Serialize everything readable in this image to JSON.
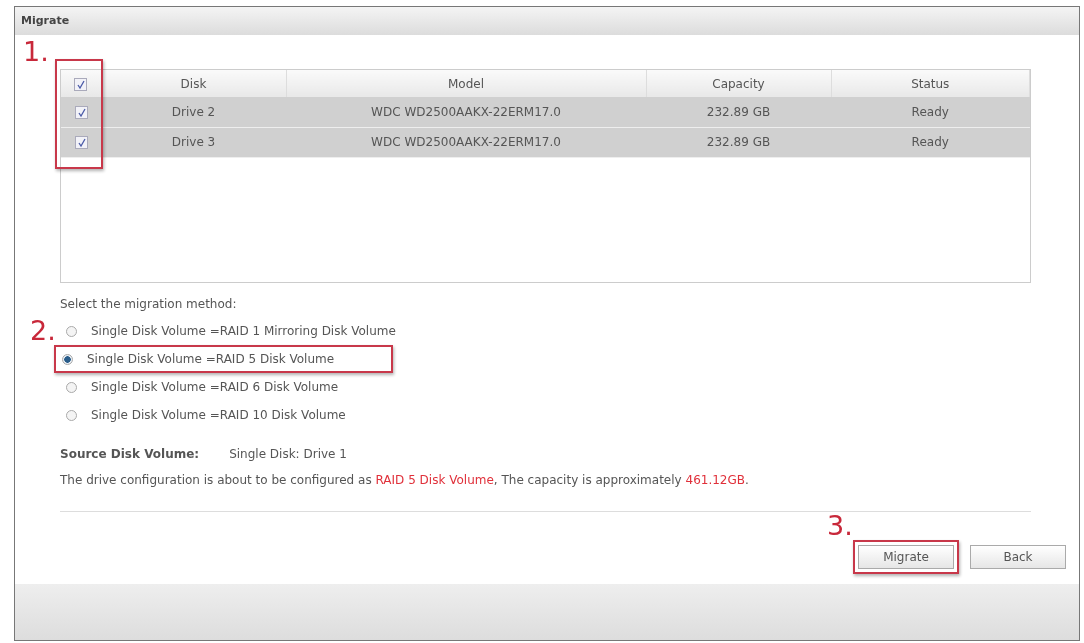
{
  "window": {
    "title": "Migrate"
  },
  "table": {
    "annotation": "1.",
    "annotated_checkboxes": true,
    "all_checked": true,
    "columns": [
      "Disk",
      "Model",
      "Capacity",
      "Status"
    ],
    "rows": [
      {
        "checked": true,
        "selected": true,
        "cells": [
          "Drive 2",
          "WDC WD2500AAKX-22ERM17.0",
          "232.89 GB",
          "Ready"
        ]
      },
      {
        "checked": true,
        "selected": true,
        "cells": [
          "Drive 3",
          "WDC WD2500AAKX-22ERM17.0",
          "232.89 GB",
          "Ready"
        ]
      }
    ]
  },
  "method": {
    "label": "Select the migration method:",
    "annotation": "2.",
    "options": [
      {
        "label": "Single Disk Volume =RAID 1 Mirroring Disk Volume",
        "selected": false,
        "annotated": false
      },
      {
        "label": "Single Disk Volume =RAID 5 Disk Volume",
        "selected": true,
        "annotated": true
      },
      {
        "label": "Single Disk Volume =RAID 6 Disk Volume",
        "selected": false,
        "annotated": false
      },
      {
        "label": "Single Disk Volume =RAID 10 Disk Volume",
        "selected": false,
        "annotated": false
      }
    ]
  },
  "source": {
    "label": "Source Disk Volume:",
    "value": "Single Disk: Drive 1"
  },
  "summary": [
    {
      "text": "The drive configuration is about to be configured as ",
      "highlight": false
    },
    {
      "text": "RAID 5 Disk Volume",
      "highlight": true
    },
    {
      "text": ", The capacity is approximately ",
      "highlight": false
    },
    {
      "text": "461.12GB",
      "highlight": true
    },
    {
      "text": ".",
      "highlight": false
    }
  ],
  "buttons": [
    {
      "label": "Migrate",
      "annotated": true,
      "annotation": "3."
    },
    {
      "label": "Back",
      "annotated": false
    }
  ]
}
